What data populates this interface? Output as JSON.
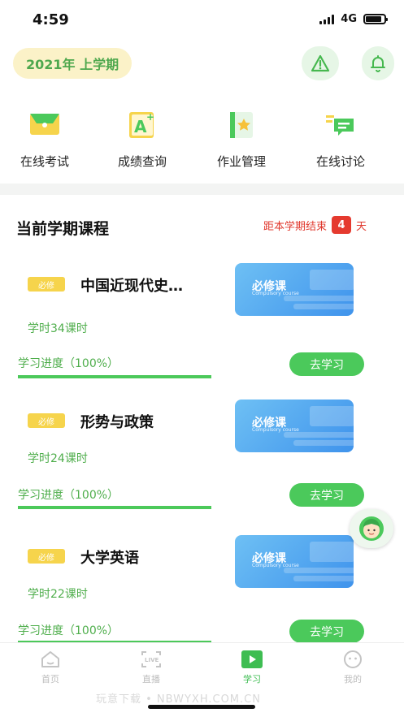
{
  "status_bar": {
    "time": "4:59",
    "network": "4G"
  },
  "header": {
    "semester": "2021年 上学期",
    "icons": [
      "warning-icon",
      "bell-icon"
    ]
  },
  "quick_menu": [
    {
      "label": "在线考试",
      "icon": "exam-icon"
    },
    {
      "label": "成绩查询",
      "icon": "grade-icon"
    },
    {
      "label": "作业管理",
      "icon": "homework-icon"
    },
    {
      "label": "在线讨论",
      "icon": "discussion-icon"
    }
  ],
  "section": {
    "title": "当前学期课程",
    "countdown_prefix": "距本学期结束",
    "countdown_days": "4",
    "countdown_suffix": "天"
  },
  "courses": [
    {
      "badge": "必修",
      "title": "中国近现代史…",
      "hours": "学时34课时",
      "progress_label": "学习进度（100%）",
      "progress": 1.0,
      "button": "去学习",
      "cover_title": "必修课",
      "cover_sub": "Compulsory course"
    },
    {
      "badge": "必修",
      "title": "形势与政策",
      "hours": "学时24课时",
      "progress_label": "学习进度（100%）",
      "progress": 1.0,
      "button": "去学习",
      "cover_title": "必修课",
      "cover_sub": "Compulsory course"
    },
    {
      "badge": "必修",
      "title": "大学英语",
      "hours": "学时22课时",
      "progress_label": "学习进度（100%）",
      "progress": 1.0,
      "button": "去学习",
      "cover_title": "必修课",
      "cover_sub": "Compulsory course"
    }
  ],
  "tab_bar": [
    {
      "label": "首页",
      "icon": "home-icon",
      "active": false
    },
    {
      "label": "直播",
      "icon": "live-icon",
      "active": false
    },
    {
      "label": "学习",
      "icon": "play-icon",
      "active": true
    },
    {
      "label": "我的",
      "icon": "profile-icon",
      "active": false
    }
  ],
  "watermark": "玩意下载 • NBWYXH.COM.CN",
  "colors": {
    "brand_green": "#4bc95b",
    "accent_red": "#e53a2f",
    "pill_bg": "#fbf2c8",
    "badge_yellow": "#f6d44c",
    "cover_blue": "#3f93ec"
  }
}
